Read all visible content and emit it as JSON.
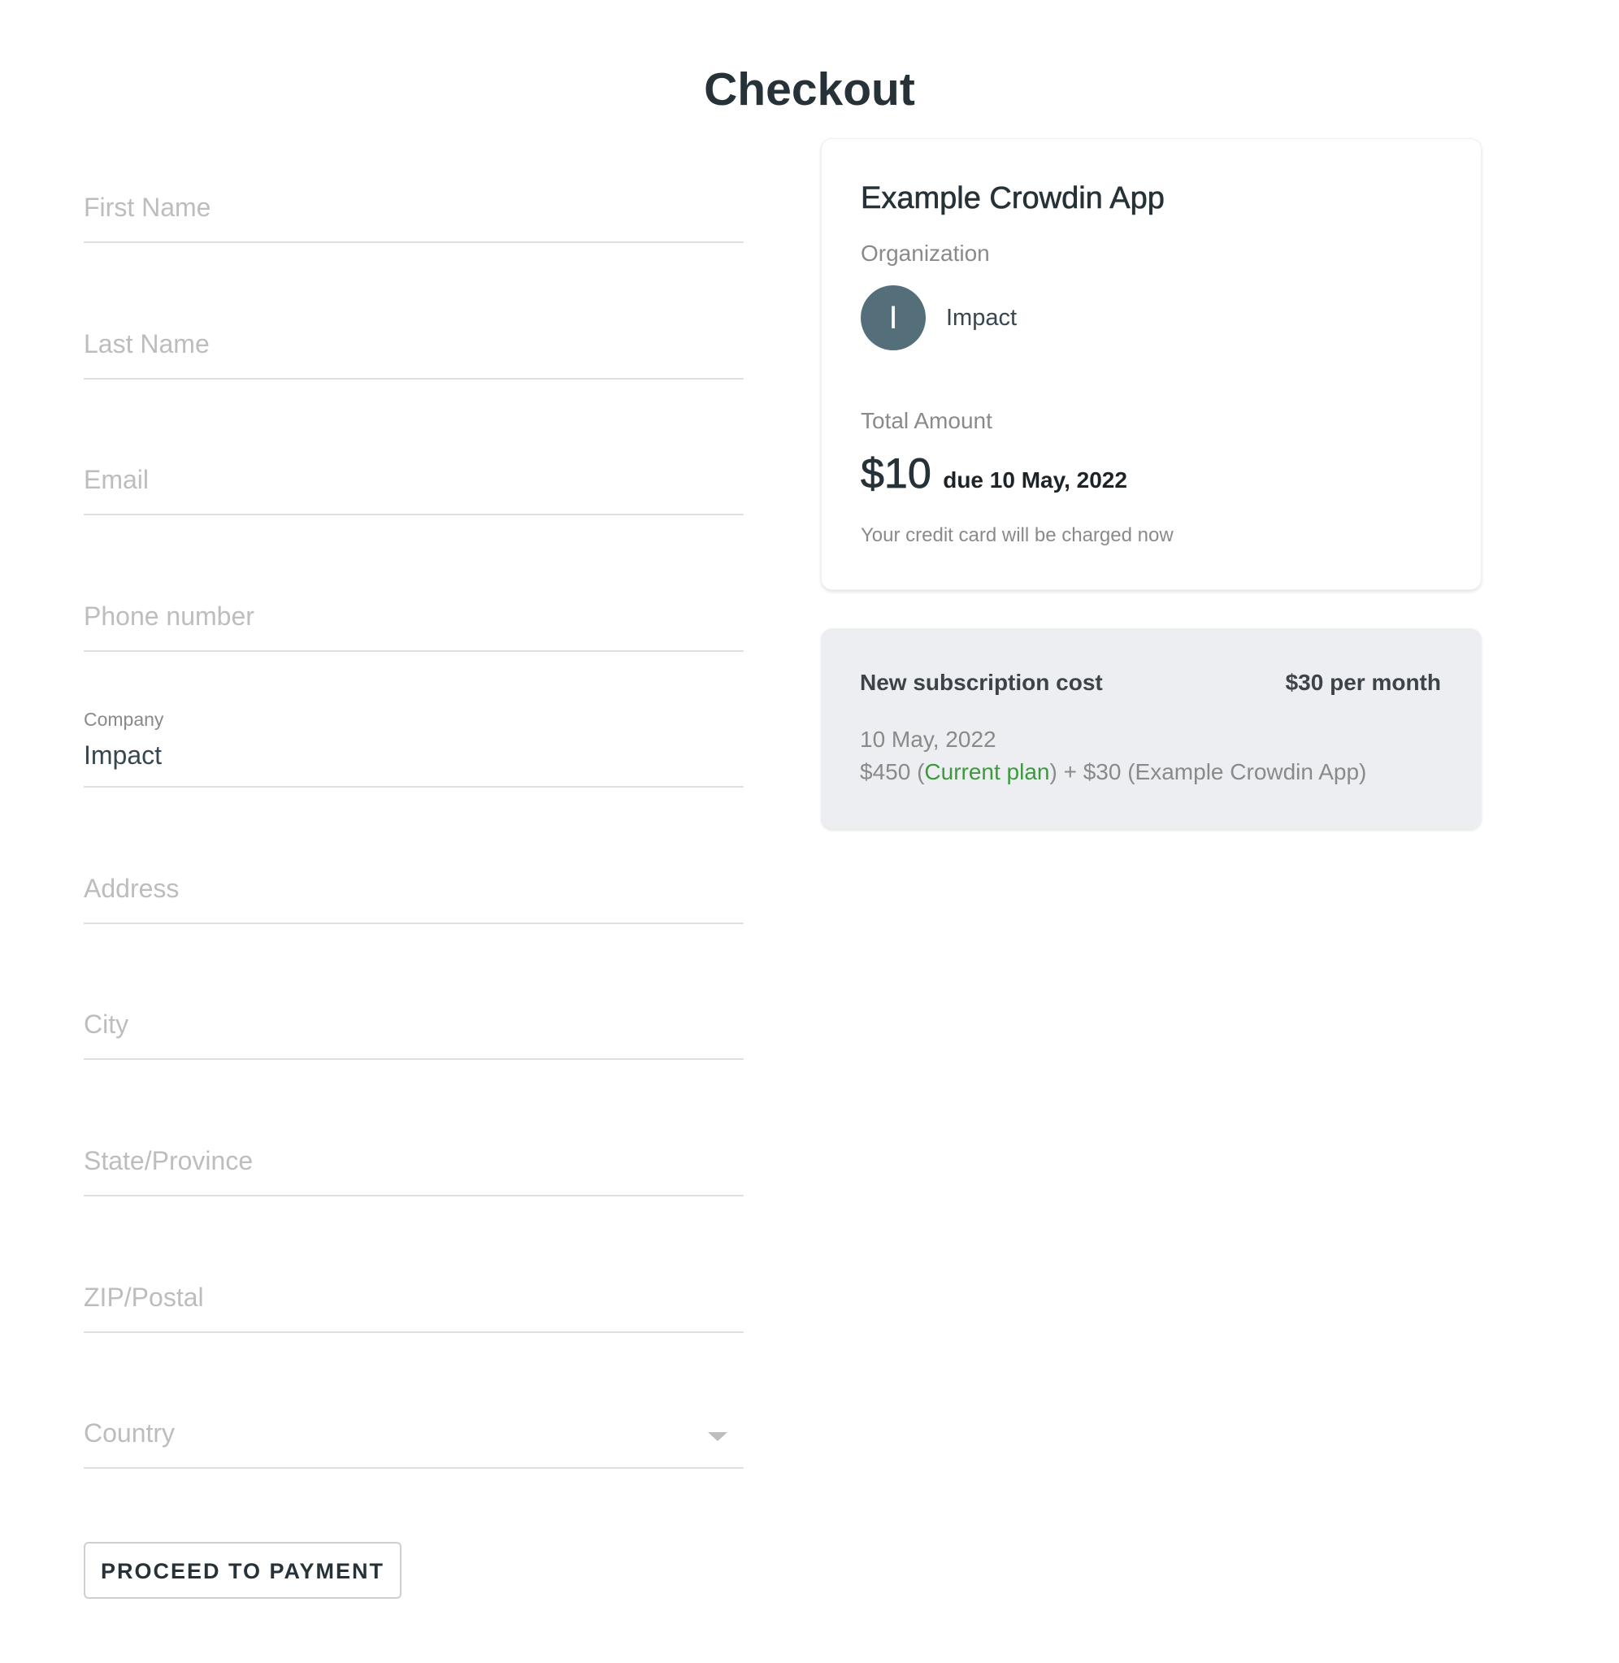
{
  "page": {
    "title": "Checkout"
  },
  "form": {
    "fields": {
      "first_name": {
        "placeholder": "First Name",
        "value": ""
      },
      "last_name": {
        "placeholder": "Last Name",
        "value": ""
      },
      "email": {
        "placeholder": "Email",
        "value": ""
      },
      "phone": {
        "placeholder": "Phone number",
        "value": ""
      },
      "company": {
        "label": "Company",
        "value": "Impact"
      },
      "address": {
        "placeholder": "Address",
        "value": ""
      },
      "city": {
        "placeholder": "City",
        "value": ""
      },
      "state": {
        "placeholder": "State/Province",
        "value": ""
      },
      "zip": {
        "placeholder": "ZIP/Postal",
        "value": ""
      },
      "country": {
        "placeholder": "Country",
        "selected": "",
        "icon": "caret-down-icon"
      }
    },
    "submit_label": "PROCEED TO PAYMENT"
  },
  "summary": {
    "app_name": "Example Crowdin App",
    "organization_label": "Organization",
    "organization": {
      "avatar_initial": "I",
      "avatar_color": "#546e7a",
      "name": "Impact"
    },
    "total_label": "Total Amount",
    "total_amount": "$10",
    "due_text": "due 10 May, 2022",
    "charge_note": "Your credit card will be charged now"
  },
  "subscription": {
    "title": "New subscription cost",
    "price": "$30 per month",
    "date": "10 May, 2022",
    "breakdown": {
      "current_amount": "$450 (",
      "current_plan_label": "Current plan",
      "rest": ") + $30 (Example Crowdin App)"
    },
    "accent_color": "#3c9a3c"
  }
}
